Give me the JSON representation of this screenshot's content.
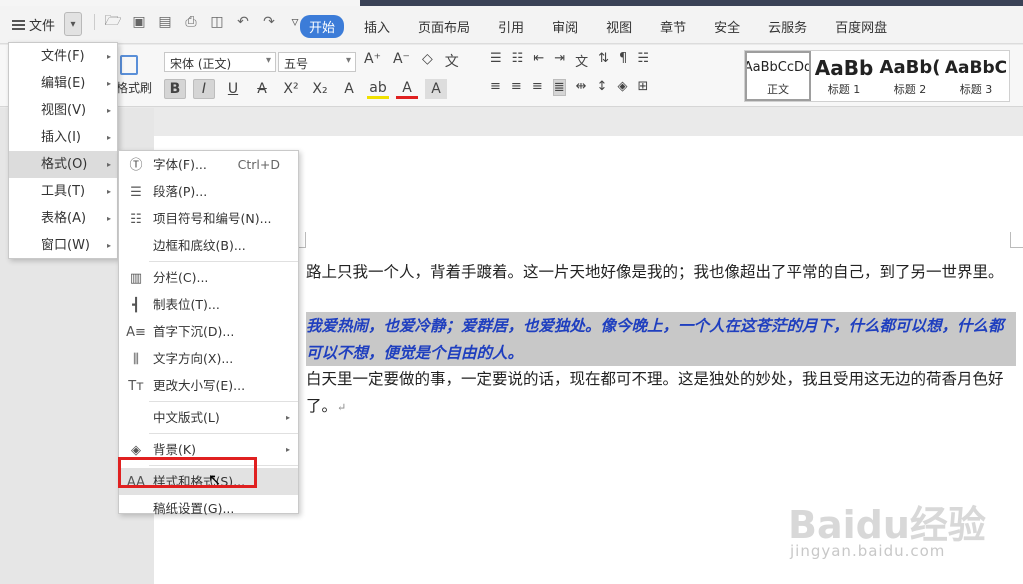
{
  "menubar": {
    "file_label": "文件",
    "tabs": [
      "开始",
      "插入",
      "页面布局",
      "引用",
      "审阅",
      "视图",
      "章节",
      "安全",
      "云服务",
      "百度网盘"
    ]
  },
  "ribbon": {
    "format_brush": "格式刷",
    "font_name": "宋体 (正文)",
    "font_size": "五号",
    "styles": [
      {
        "preview": "AaBbCcDd",
        "name": "正文"
      },
      {
        "preview": "AaBb",
        "name": "标题 1"
      },
      {
        "preview": "AaBb(",
        "name": "标题 2"
      },
      {
        "preview": "AaBbC",
        "name": "标题 3"
      }
    ]
  },
  "file_menu": {
    "items": [
      {
        "label": "文件(F)",
        "arrow": "▸"
      },
      {
        "label": "编辑(E)",
        "arrow": "▸"
      },
      {
        "label": "视图(V)",
        "arrow": "▸"
      },
      {
        "label": "插入(I)",
        "arrow": "▸"
      },
      {
        "label": "格式(O)",
        "arrow": "▸"
      },
      {
        "label": "工具(T)",
        "arrow": "▸"
      },
      {
        "label": "表格(A)",
        "arrow": "▸"
      },
      {
        "label": "窗口(W)",
        "arrow": "▸"
      }
    ]
  },
  "format_menu": {
    "items": [
      {
        "label": "字体(F)...",
        "shortcut": "Ctrl+D",
        "icon": "font-icon"
      },
      {
        "label": "段落(P)...",
        "icon": "paragraph-icon"
      },
      {
        "label": "项目符号和编号(N)...",
        "icon": "bullets-icon"
      },
      {
        "label": "边框和底纹(B)..."
      },
      {
        "label": "分栏(C)...",
        "icon": "columns-icon"
      },
      {
        "label": "制表位(T)...",
        "icon": "tabstop-icon"
      },
      {
        "label": "首字下沉(D)...",
        "icon": "dropcap-icon"
      },
      {
        "label": "文字方向(X)...",
        "icon": "text-direction-icon"
      },
      {
        "label": "更改大小写(E)...",
        "icon": "change-case-icon"
      },
      {
        "label": "中文版式(L)",
        "arrow": "▸"
      },
      {
        "label": "背景(K)",
        "arrow": "▸",
        "icon": "background-icon"
      },
      {
        "label": "样式和格式(S)...",
        "icon": "styles-icon"
      },
      {
        "label": "稿纸设置(G)..."
      }
    ]
  },
  "document": {
    "para1": "路上只我一个人，背着手踱着。这一片天地好像是我的；我也像超出了平常的自己，到了另一世界里。",
    "para2": "我爱热闹，也爱冷静；爱群居，也爱独处。像今晚上，一个人在这苍茫的月下，什么都可以想，什么都可以不想，便觉是个自由的人。",
    "para3": "白天里一定要做的事，一定要说的话，现在都可不理。这是独处的妙处，我且受用这无边的荷香月色好了。",
    "para_mark": "↵"
  },
  "watermark": {
    "logo": "Baidu经验",
    "url": "jingyan.baidu.com"
  }
}
